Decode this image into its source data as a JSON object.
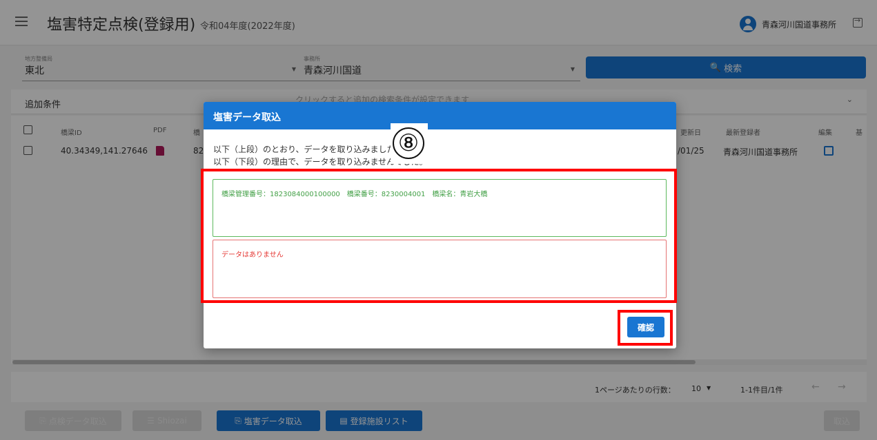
{
  "header": {
    "title": "塩害特定点検(登録用)",
    "fiscal_year": "令和04年度(2022年度)",
    "user": "青森河川国道事務所"
  },
  "filters": {
    "region_label": "地方整備局",
    "region_value": "東北",
    "office_label": "事務所",
    "office_value": "青森河川国道",
    "search_button": "検索"
  },
  "conditions": {
    "label": "追加条件",
    "hint": "クリックすると追加の検索条件が設定できます"
  },
  "table": {
    "headers": [
      "橋梁ID",
      "PDF",
      "橋",
      "更新日",
      "最新登録者",
      "編集",
      "基"
    ],
    "rows": [
      {
        "id": "40.34349,141.27646",
        "partial": "82",
        "date": "/01/25",
        "registrant": "青森河川国道事務所"
      }
    ]
  },
  "pagination": {
    "rows_per_page_label": "1ページあたりの行数：",
    "rows_per_page": "10",
    "count": "1-1件目/1件"
  },
  "toolbar": {
    "buttons": [
      "点検データ取込",
      "Shiozai",
      "塩害データ取込",
      "登録施設リスト",
      "取込"
    ]
  },
  "dialog": {
    "title": "塩害データ取込",
    "msg1": "以下（上段）のとおり、データを取り込みました。",
    "msg2": "以下（下段）の理由で、データを取り込みませんでした。",
    "success_text": "橋梁管理番号：1823084000100000　橋梁番号：8230004001　橋梁名：青岩大橋",
    "error_text": "データはありません",
    "confirm_button": "確認"
  },
  "annotation": {
    "label": "⑧",
    "color": "#ff0000"
  }
}
